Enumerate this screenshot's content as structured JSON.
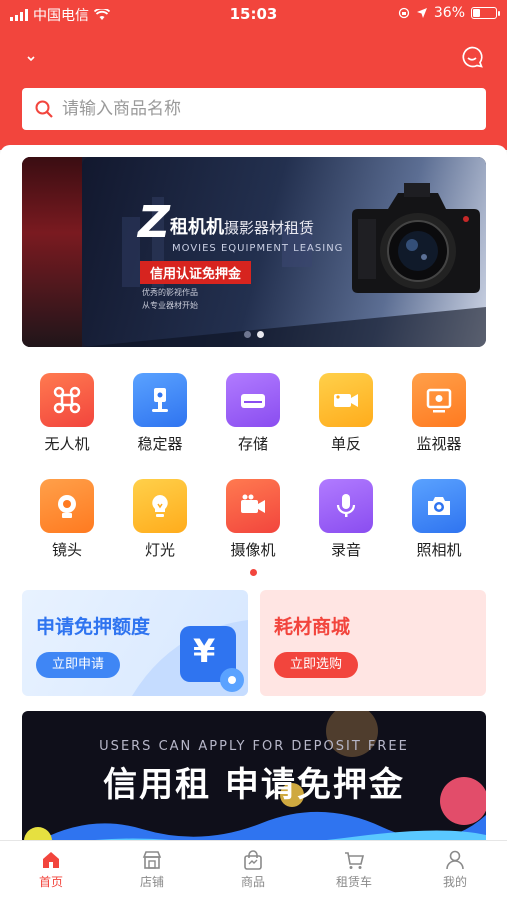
{
  "status_bar": {
    "carrier": "中国电信",
    "time": "15:03",
    "battery": "36%"
  },
  "search": {
    "placeholder": "请输入商品名称"
  },
  "banner": {
    "z_letter": "Z",
    "brand": "租机机",
    "brand_sub": "摄影器材租赁",
    "english": "MOVIES EQUIPMENT LEASING",
    "tag": "信用认证免押金",
    "line1": "优秀的影视作品",
    "line2": "从专业器材开始"
  },
  "categories": [
    {
      "label": "无人机",
      "icon": "drone-icon",
      "color_from": "#ff7a50",
      "color_to": "#f2453d"
    },
    {
      "label": "稳定器",
      "icon": "gimbal-icon",
      "color_from": "#5aa2ff",
      "color_to": "#2f74f0"
    },
    {
      "label": "存储",
      "icon": "storage-icon",
      "color_from": "#b17bff",
      "color_to": "#8a4df0"
    },
    {
      "label": "单反",
      "icon": "video-camera-icon",
      "color_from": "#ffd04a",
      "color_to": "#ffac1c"
    },
    {
      "label": "监视器",
      "icon": "monitor-icon",
      "color_from": "#ffa04a",
      "color_to": "#ff7a20"
    },
    {
      "label": "镜头",
      "icon": "lens-icon",
      "color_from": "#ffa04a",
      "color_to": "#ff7a20"
    },
    {
      "label": "灯光",
      "icon": "light-bulb-icon",
      "color_from": "#ffd04a",
      "color_to": "#ffac1c"
    },
    {
      "label": "摄像机",
      "icon": "camcorder-icon",
      "color_from": "#ff7a50",
      "color_to": "#f2453d"
    },
    {
      "label": "录音",
      "icon": "microphone-icon",
      "color_from": "#b17bff",
      "color_to": "#8a4df0"
    },
    {
      "label": "照相机",
      "icon": "photo-camera-icon",
      "color_from": "#5aa2ff",
      "color_to": "#2f74f0"
    }
  ],
  "cards": {
    "deposit": {
      "title": "申请免押额度",
      "button": "立即申请",
      "symbol": "¥"
    },
    "consumables": {
      "title": "耗材商城",
      "button": "立即选购"
    }
  },
  "promo": {
    "english": "USERS CAN APPLY FOR DEPOSIT FREE",
    "headline": "信用租  申请免押金"
  },
  "tabs": [
    {
      "label": "首页",
      "icon": "home-icon"
    },
    {
      "label": "店铺",
      "icon": "store-icon"
    },
    {
      "label": "商品",
      "icon": "shopping-bag-icon"
    },
    {
      "label": "租赁车",
      "icon": "cart-icon"
    },
    {
      "label": "我的",
      "icon": "user-icon"
    }
  ],
  "colors": {
    "accent": "#f2453d",
    "blue": "#2f74f0"
  }
}
